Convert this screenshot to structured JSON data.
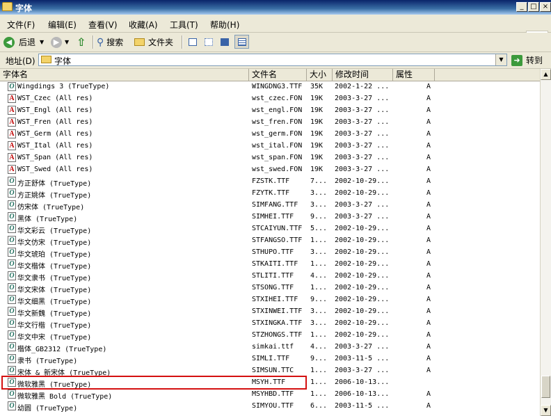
{
  "window": {
    "title": "字体"
  },
  "menu": [
    "文件(F)",
    "编辑(E)",
    "查看(V)",
    "收藏(A)",
    "工具(T)",
    "帮助(H)"
  ],
  "toolbar": {
    "back_label": "后退",
    "search_label": "搜索",
    "folders_label": "文件夹"
  },
  "address": {
    "label": "地址(D)",
    "value": "字体",
    "go_label": "转到"
  },
  "columns": {
    "name": "字体名",
    "file": "文件名",
    "size": "大小",
    "modified": "修改时间",
    "attr": "属性"
  },
  "colors": {
    "truetype_icon": "#1a6b5a",
    "raster_icon": "#c00000",
    "highlight_border": "#d41010",
    "titlebar": "#0a246a"
  },
  "rows": [
    {
      "icon": "O",
      "name": "Wingdings 3 (TrueType)",
      "file": "WINGDNG3.TTF",
      "size": "35K",
      "modified": "2002-1-22 ...",
      "attr": "A"
    },
    {
      "icon": "A",
      "name": "WST_Czec (All res)",
      "file": "wst_czec.FON",
      "size": "19K",
      "modified": "2003-3-27 ...",
      "attr": "A"
    },
    {
      "icon": "A",
      "name": "WST_Engl (All res)",
      "file": "wst_engl.FON",
      "size": "19K",
      "modified": "2003-3-27 ...",
      "attr": "A"
    },
    {
      "icon": "A",
      "name": "WST_Fren (All res)",
      "file": "wst_fren.FON",
      "size": "19K",
      "modified": "2003-3-27 ...",
      "attr": "A"
    },
    {
      "icon": "A",
      "name": "WST_Germ (All res)",
      "file": "wst_germ.FON",
      "size": "19K",
      "modified": "2003-3-27 ...",
      "attr": "A"
    },
    {
      "icon": "A",
      "name": "WST_Ital (All res)",
      "file": "wst_ital.FON",
      "size": "19K",
      "modified": "2003-3-27 ...",
      "attr": "A"
    },
    {
      "icon": "A",
      "name": "WST_Span (All res)",
      "file": "wst_span.FON",
      "size": "19K",
      "modified": "2003-3-27 ...",
      "attr": "A"
    },
    {
      "icon": "A",
      "name": "WST_Swed (All res)",
      "file": "wst_swed.FON",
      "size": "19K",
      "modified": "2003-3-27 ...",
      "attr": "A"
    },
    {
      "icon": "O",
      "name": "方正舒体 (TrueType)",
      "file": "FZSTK.TTF",
      "size": "7...",
      "modified": "2002-10-29...",
      "attr": "A"
    },
    {
      "icon": "O",
      "name": "方正姚体 (TrueType)",
      "file": "FZYTK.TTF",
      "size": "3...",
      "modified": "2002-10-29...",
      "attr": "A"
    },
    {
      "icon": "O",
      "name": "仿宋体 (TrueType)",
      "file": "SIMFANG.TTF",
      "size": "3...",
      "modified": "2003-3-27 ...",
      "attr": "A"
    },
    {
      "icon": "O",
      "name": "黑体 (TrueType)",
      "file": "SIMHEI.TTF",
      "size": "9...",
      "modified": "2003-3-27 ...",
      "attr": "A"
    },
    {
      "icon": "O",
      "name": "华文彩云 (TrueType)",
      "file": "STCAIYUN.TTF",
      "size": "5...",
      "modified": "2002-10-29...",
      "attr": "A"
    },
    {
      "icon": "O",
      "name": "华文仿宋 (TrueType)",
      "file": "STFANGSO.TTF",
      "size": "1...",
      "modified": "2002-10-29...",
      "attr": "A"
    },
    {
      "icon": "O",
      "name": "华文琥珀 (TrueType)",
      "file": "STHUPO.TTF",
      "size": "3...",
      "modified": "2002-10-29...",
      "attr": "A"
    },
    {
      "icon": "O",
      "name": "华文楷体 (TrueType)",
      "file": "STKAITI.TTF",
      "size": "1...",
      "modified": "2002-10-29...",
      "attr": "A"
    },
    {
      "icon": "O",
      "name": "华文隶书 (TrueType)",
      "file": "STLITI.TTF",
      "size": "4...",
      "modified": "2002-10-29...",
      "attr": "A"
    },
    {
      "icon": "O",
      "name": "华文宋体 (TrueType)",
      "file": "STSONG.TTF",
      "size": "1...",
      "modified": "2002-10-29...",
      "attr": "A"
    },
    {
      "icon": "O",
      "name": "华文细黑 (TrueType)",
      "file": "STXIHEI.TTF",
      "size": "9...",
      "modified": "2002-10-29...",
      "attr": "A"
    },
    {
      "icon": "O",
      "name": "华文新魏 (TrueType)",
      "file": "STXINWEI.TTF",
      "size": "3...",
      "modified": "2002-10-29...",
      "attr": "A"
    },
    {
      "icon": "O",
      "name": "华文行楷 (TrueType)",
      "file": "STXINGKA.TTF",
      "size": "3...",
      "modified": "2002-10-29...",
      "attr": "A"
    },
    {
      "icon": "O",
      "name": "华文中宋 (TrueType)",
      "file": "STZHONGS.TTF",
      "size": "1...",
      "modified": "2002-10-29...",
      "attr": "A"
    },
    {
      "icon": "O",
      "name": "楷体_GB2312 (TrueType)",
      "file": "simkai.ttf",
      "size": "4...",
      "modified": "2003-3-27 ...",
      "attr": "A"
    },
    {
      "icon": "O",
      "name": "隶书 (TrueType)",
      "file": "SIMLI.TTF",
      "size": "9...",
      "modified": "2003-11-5 ...",
      "attr": "A"
    },
    {
      "icon": "O",
      "name": "宋体 & 新宋体 (TrueType)",
      "file": "SIMSUN.TTC",
      "size": "1...",
      "modified": "2003-3-27 ...",
      "attr": "A"
    },
    {
      "icon": "O",
      "name": "微软雅黑 (TrueType)",
      "file": "MSYH.TTF",
      "size": "1...",
      "modified": "2006-10-13...",
      "attr": ""
    },
    {
      "icon": "O",
      "name": "微软雅黑 Bold (TrueType)",
      "file": "MSYHBD.TTF",
      "size": "1...",
      "modified": "2006-10-13...",
      "attr": "A"
    },
    {
      "icon": "O",
      "name": "幼圆 (TrueType)",
      "file": "SIMYOU.TTF",
      "size": "6...",
      "modified": "2003-11-5 ...",
      "attr": "A"
    }
  ]
}
